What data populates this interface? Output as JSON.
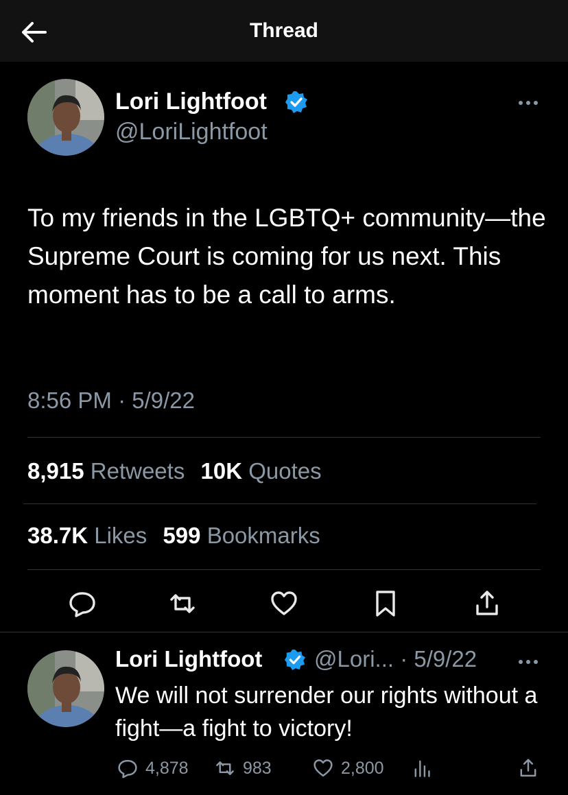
{
  "header": {
    "title": "Thread",
    "back_icon": "arrow-left-icon"
  },
  "main_tweet": {
    "author_name": "Lori Lightfoot",
    "author_handle": "@LoriLightfoot",
    "text": "To my friends in the LGBTQ+ community—the Supreme Court is coming for us next. This moment has to be a call to arms.",
    "timestamp": "8:56 PM · 5/9/22",
    "retweets_count": "8,915",
    "retweets_label": "Retweets",
    "quotes_count": "10K",
    "quotes_label": "Quotes",
    "likes_count": "38.7K",
    "likes_label": "Likes",
    "bookmarks_count": "599",
    "bookmarks_label": "Bookmarks"
  },
  "reply_tweet": {
    "author_name": "Lori Lightfoot",
    "handle_date": "@Lori... · 5/9/22",
    "text": "We will not surrender our rights without a fight—a fight to victory!",
    "replies": "4,878",
    "retweets": "983",
    "likes": "2,800"
  },
  "colors": {
    "background": "#000000",
    "verified": "#1d9bf0",
    "muted": "#8b98a5",
    "divider": "#2f3336"
  }
}
